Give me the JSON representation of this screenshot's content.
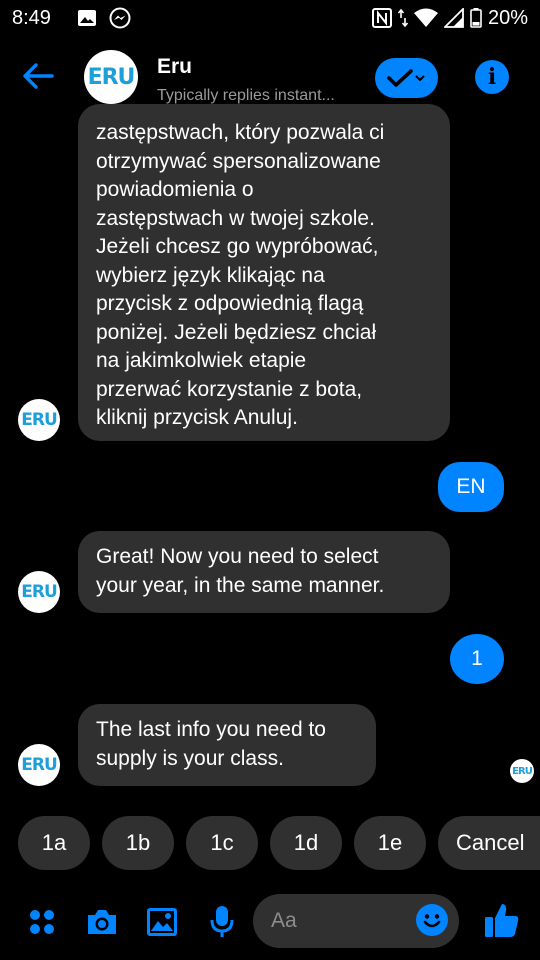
{
  "status_bar": {
    "time": "8:49",
    "battery": "20%",
    "icons": [
      "image-icon",
      "messenger-icon",
      "nfc-icon",
      "data-arrows-icon",
      "wifi-icon",
      "signal-icon",
      "battery-icon"
    ]
  },
  "header": {
    "name": "Eru",
    "subtitle": "Typically replies instant...",
    "avatar_text": "ERU"
  },
  "messages": {
    "m1_lines": [
      "zastępstwach, który pozwala ci",
      "otrzymywać spersonalizowane",
      "powiadomienia o",
      "zastępstwach w twojej szkole.",
      "Jeżeli chcesz go wypróbować,",
      "wybierz język klikając na",
      "przycisk z odpowiednią flagą",
      "poniżej. Jeżeli będziesz chciał",
      "na jakimkolwiek etapie",
      "przerwać korzystanie z bota,",
      "kliknij przycisk Anuluj."
    ],
    "m2": "EN",
    "m3_lines": [
      "Great! Now you need to select",
      "your year, in the same manner."
    ],
    "m4": "1",
    "m5_lines": [
      "The last info you need to",
      "supply is your class."
    ]
  },
  "quick_replies": [
    "1a",
    "1b",
    "1c",
    "1d",
    "1e",
    "Cancel"
  ],
  "composer": {
    "placeholder": "Aa",
    "icons": [
      "apps-icon",
      "camera-icon",
      "gallery-icon",
      "microphone-icon",
      "emoji-icon",
      "thumbs-up-icon"
    ]
  },
  "colors": {
    "accent": "#0084ff",
    "bubble_in": "#303030",
    "background": "#000000",
    "logo": "#1f9fd9"
  }
}
